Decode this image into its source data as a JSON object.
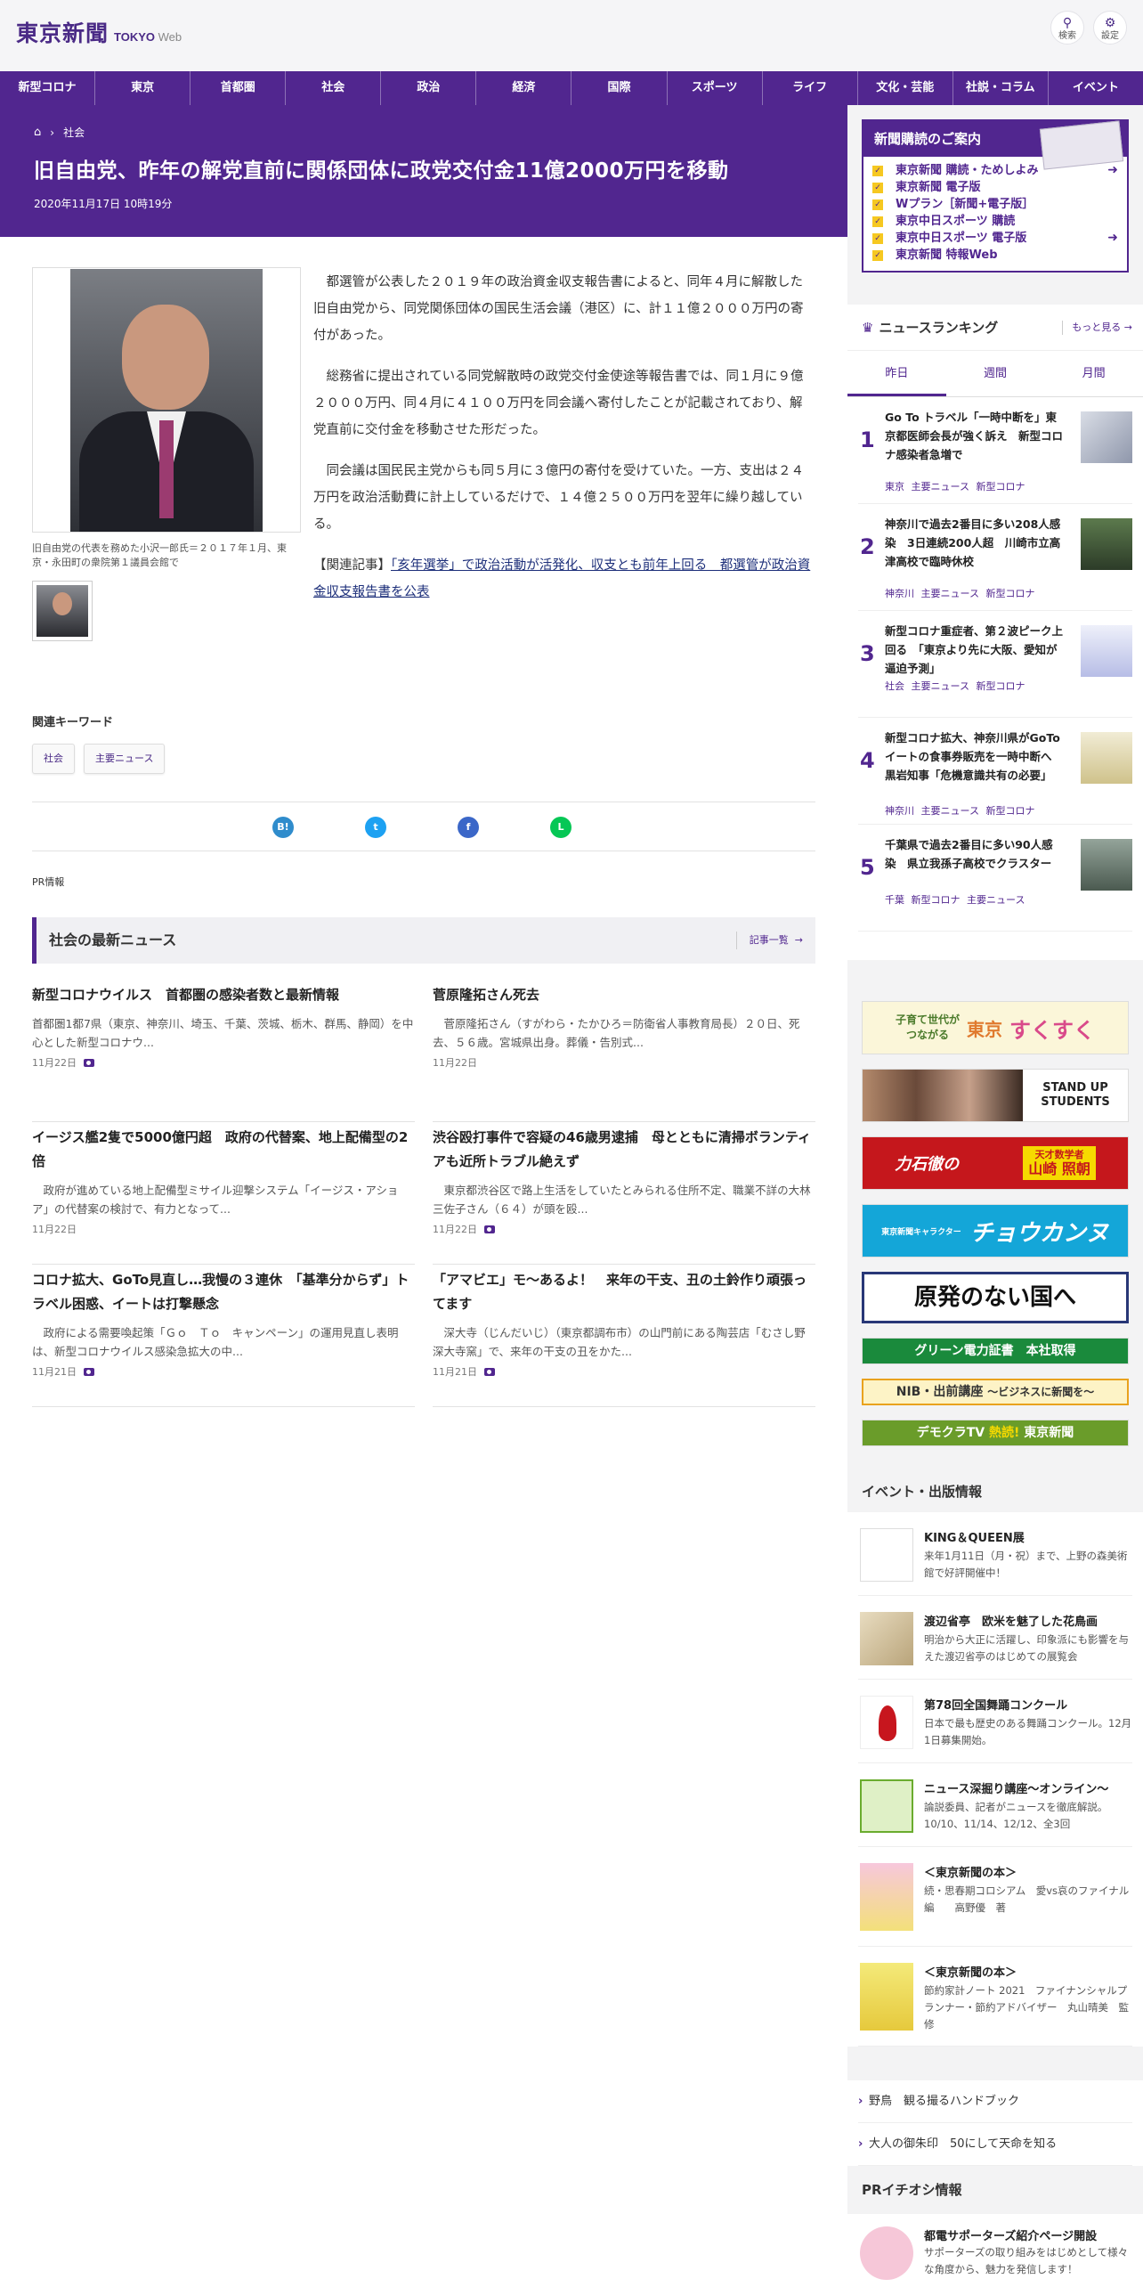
{
  "header": {
    "logo_jp": "東京新聞",
    "logo_en_bold": "TOKYO",
    "logo_en_light": "Web",
    "search_label": "検索",
    "settings_label": "設定"
  },
  "nav": [
    "新型コロナ",
    "東京",
    "首都圏",
    "社会",
    "政治",
    "経済",
    "国際",
    "スポーツ",
    "ライフ",
    "文化・芸能",
    "社説・コラム",
    "イベント"
  ],
  "article": {
    "breadcrumb": "社会",
    "title": "旧自由党、昨年の解党直前に関係団体に政党交付金11億2000万円を移動",
    "date": "2020年11月17日 10時19分",
    "caption": "旧自由党の代表を務めた小沢一郎氏＝２０１７年１月、東京・永田町の衆院第１議員会館で",
    "paragraphs": [
      "都選管が公表した２０１９年の政治資金収支報告書によると、同年４月に解散した旧自由党から、同党関係団体の国民生活会議（港区）に、計１１億２０００万円の寄付があった。",
      "総務省に提出されている同党解散時の政党交付金使途等報告書では、同１月に９億２０００万円、同４月に４１００万円を同会議へ寄付したことが記載されており、解党直前に交付金を移動させた形だった。",
      "同会議は国民民主党からも同５月に３億円の寄付を受けていた。一方、支出は２４万円を政治活動費に計上しているだけで、１４億２５００万円を翌年に繰り越している。"
    ],
    "related_prefix": "【関連記事】",
    "related_link": "「亥年選挙」で政治活動が活発化、収支とも前年上回る　都選管が政治資金収支報告書を公表",
    "keywords_title": "関連キーワード",
    "keywords": [
      "社会",
      "主要ニュース"
    ],
    "pr_label": "PR情報"
  },
  "share": {
    "hatena": "B!",
    "twitter": "t",
    "facebook": "f",
    "line": "L"
  },
  "latest": {
    "title": "社会の最新ニュース",
    "more": "記事一覧",
    "items": [
      {
        "title": "新型コロナウイルス　首都圏の感染者数と最新情報",
        "lead": "首都圏1都7県（東京、神奈川、埼玉、千葉、茨城、栃木、群馬、静岡）を中心とした新型コロナウ...",
        "date": "11月22日"
      },
      {
        "title": "菅原隆拓さん死去",
        "lead": "　菅原隆拓さん（すがわら・たかひろ＝防衛省人事教育局長）２０日、死去、５６歳。宮城県出身。葬儀・告別式...",
        "date": "11月22日"
      },
      {
        "title": "イージス艦2隻で5000億円超　政府の代替案、地上配備型の2倍",
        "lead": "　政府が進めている地上配備型ミサイル迎撃システム「イージス・アショア」の代替案の検討で、有力となって...",
        "date": "11月22日"
      },
      {
        "title": "渋谷殴打事件で容疑の46歳男逮捕　母とともに清掃ボランティアも近所トラブル絶えず",
        "lead": "　東京都渋谷区で路上生活をしていたとみられる住所不定、職業不詳の大林三佐子さん（６４）が頭を殴...",
        "date": "11月22日"
      },
      {
        "title": "コロナ拡大、GoTo見直し…我慢の３連休　「基準分からず」トラベル困惑、イートは打撃懸念",
        "lead": "　政府による需要喚起策「Ｇｏ　Ｔｏ　キャンペーン」の運用見直し表明は、新型コロナウイルス感染急拡大の中...",
        "date": "11月21日"
      },
      {
        "title": "「アマビエ」モ～あるよ！　来年の干支、丑の土鈴作り頑張ってます",
        "lead": "　深大寺（じんだいじ）（東京都調布市）の山門前にある陶芸店「むさし野深大寺窯」で、来年の干支の丑をかた...",
        "date": "11月21日"
      }
    ]
  },
  "subscribe": {
    "title": "新聞購読のご案内",
    "items": [
      "東京新聞 購読・ためしよみ",
      "東京新聞 電子版",
      "Wプラン［新聞+電子版］",
      "東京中日スポーツ 購読",
      "東京中日スポーツ 電子版",
      "東京新聞 特報Web"
    ]
  },
  "ranking": {
    "title": "ニュースランキング",
    "more": "もっと見る",
    "tabs": [
      "昨日",
      "週間",
      "月間"
    ],
    "items": [
      {
        "n": "1",
        "title": "Go To トラベル「一時中断を」東京都医師会長が強く訴え　新型コロナ感染者急増で",
        "tags": "東京 主要ニュース 新型コロナ"
      },
      {
        "n": "2",
        "title": "神奈川で過去2番目に多い208人感染　3日連続200人超　川崎市立高津高校で臨時休校",
        "tags": "神奈川 主要ニュース 新型コロナ"
      },
      {
        "n": "3",
        "title": "新型コロナ重症者、第２波ピーク上回る　「東京より先に大阪、愛知が逼迫予測」",
        "tags": "社会 主要ニュース 新型コロナ"
      },
      {
        "n": "4",
        "title": "新型コロナ拡大、神奈川県がGoToイートの食事券販売を一時中断へ　黒岩知事「危機意識共有の必要」",
        "tags": "神奈川 主要ニュース 新型コロナ"
      },
      {
        "n": "5",
        "title": "千葉県で過去2番目に多い90人感染　県立我孫子高校でクラスター",
        "tags": "千葉 新型コロナ 主要ニュース"
      }
    ]
  },
  "banners": {
    "sukusuku_a": "子育て世代が",
    "sukusuku_b": "つながる",
    "sukusuku_c": "東京",
    "sukusuku_d": "すくすく",
    "students_a": "STAND UP",
    "students_b": "STUDENTS",
    "rikiishi_a": "力石徹の",
    "rikiishi_b": "天才数学者",
    "rikiishi_c": "山崎 照朝",
    "chokanzu_a": "東京新聞キャラクター",
    "chokanzu_b": "チョウカンヌ",
    "genpatsu": "原発のない国へ",
    "green": "グリーン電力証書　本社取得",
    "nib_a": "NIB・出前講座",
    "nib_b": "～ビジネスに新聞を～",
    "democra_a": "デモクラTV",
    "democra_b": "熱読!",
    "democra_c": "東京新聞"
  },
  "events": {
    "title": "イベント・出版情報",
    "items": [
      {
        "title": "KING＆QUEEN展",
        "sub": "来年1月11日（月・祝）まで、上野の森美術館で好評開催中！"
      },
      {
        "title": "渡辺省亭　欧米を魅了した花鳥画",
        "sub": "明治から大正に活躍し、印象派にも影響を与えた渡辺省亭のはじめての展覧会"
      },
      {
        "title": "第78回全国舞踊コンクール",
        "sub": "日本で最も歴史のある舞踊コンクール。12月1日募集開始。"
      },
      {
        "title": "ニュース深掘り講座～オンライン～",
        "sub": "論説委員、記者がニュースを徹底解説。10/10、11/14、12/12、全3回"
      },
      {
        "title": "＜東京新聞の本＞",
        "sub": "続・思春期コロシアム　愛vs哀のファイナル編　　高野優　著"
      },
      {
        "title": "＜東京新聞の本＞",
        "sub": "節約家計ノート 2021　ファイナンシャルプランナー・節約アドバイザー　丸山晴美　監修"
      }
    ]
  },
  "links": [
    "野鳥　観る撮るハンドブック",
    "大人の御朱印　50にして天命を知る"
  ],
  "pr": {
    "title": "PRイチオシ情報",
    "item_title": "都電サポーターズ紹介ページ開設",
    "item_sub": "サポーターズの取り組みをはじめとして様々な角度から、魅力を発信します！"
  },
  "colors": {
    "brand": "#51268f",
    "accent_yellow": "#f6c821"
  }
}
